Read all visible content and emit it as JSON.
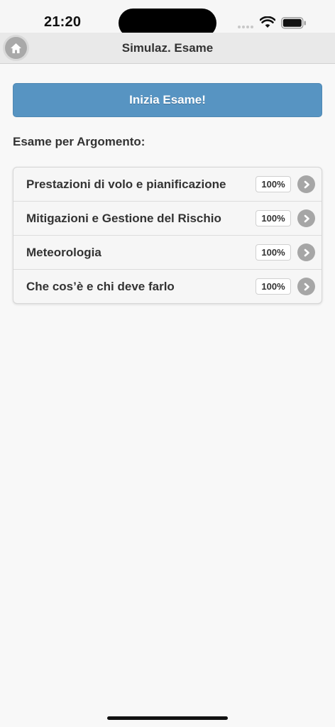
{
  "status_bar": {
    "time": "21:20"
  },
  "header": {
    "title": "Simulaz. Esame",
    "home_icon": "home-icon"
  },
  "main": {
    "start_button_label": "Inizia Esame!",
    "section_label": "Esame per Argomento:",
    "topics": [
      {
        "label": "Prestazioni di volo e pianificazione",
        "badge": "100%"
      },
      {
        "label": "Mitigazioni e Gestione del Rischio",
        "badge": "100%"
      },
      {
        "label": "Meteorologia",
        "badge": "100%"
      },
      {
        "label": "Che cos’è e chi deve farlo",
        "badge": "100%"
      }
    ]
  },
  "colors": {
    "accent": "#5794c2",
    "header_bg": "#e9e9e9",
    "page_bg": "#f8f8f8",
    "chevron_bg": "#a6a6a6"
  }
}
